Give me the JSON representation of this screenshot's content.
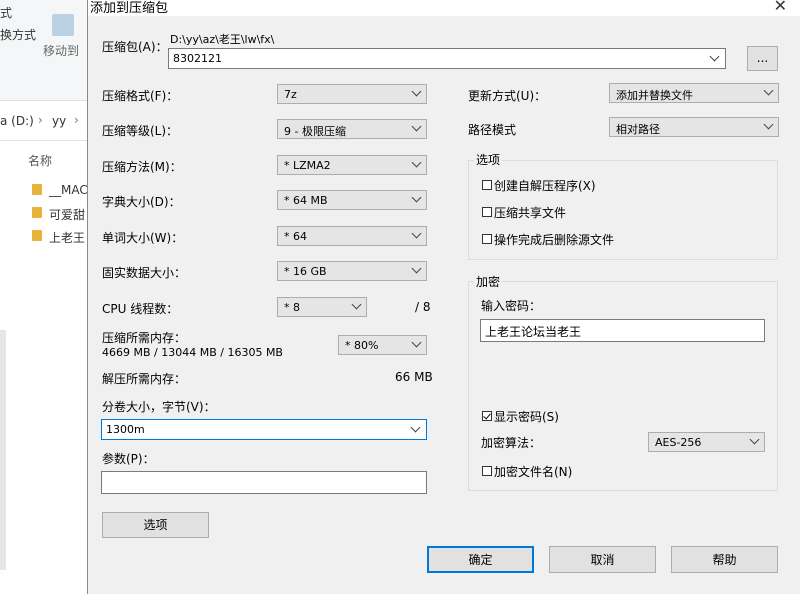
{
  "explorer": {
    "ribbon_label_1": "式",
    "ribbon_label_2": "换方式",
    "ribbon_move_label": "移动到",
    "path_segment_1": "a (D:)",
    "path_segment_2": "yy",
    "name_header": "名称",
    "files": [
      "__MAC",
      "可爱甜",
      "上老王"
    ]
  },
  "dialog": {
    "title": "添加到压缩包",
    "close_glyph": "✕",
    "archive_label": "压缩包(A)：",
    "archive_path": "D:\\yy\\az\\老王\\lw\\fx\\",
    "archive_name": "8302121",
    "browse_label": "...",
    "format_label": "压缩格式(F)：",
    "format_value": "7z",
    "level_label": "压缩等级(L)：",
    "level_value": "9 - 极限压缩",
    "method_label": "压缩方法(M)：",
    "method_value": "* LZMA2",
    "dict_label": "字典大小(D)：",
    "dict_value": "* 64 MB",
    "word_label": "单词大小(W)：",
    "word_value": "* 64",
    "solid_label": "固实数据大小：",
    "solid_value": "* 16 GB",
    "cpu_label": "CPU 线程数：",
    "cpu_value": "* 8",
    "cpu_total": "/ 8",
    "mem_label": "压缩所需内存：",
    "mem_detail": "4669 MB / 13044 MB / 16305 MB",
    "mem_percent": "* 80%",
    "decomp_label": "解压所需内存：",
    "decomp_value": "66 MB",
    "split_label": "分卷大小，字节(V)：",
    "split_value": "1300m",
    "params_label": "参数(P)：",
    "params_value": "",
    "options_button": "选项",
    "update_label": "更新方式(U)：",
    "update_value": "添加并替换文件",
    "path_mode_label": "路径模式",
    "path_mode_value": "相对路径",
    "options_group": "选项",
    "opt_sfx": "创建自解压程序(X)",
    "opt_shared": "压缩共享文件",
    "opt_delete": "操作完成后删除源文件",
    "encrypt_group": "加密",
    "password_label": "输入密码：",
    "password_value": "上老王论坛当老王",
    "show_password": "显示密码(S)",
    "enc_method_label": "加密算法：",
    "enc_method_value": "AES-256",
    "encrypt_names": "加密文件名(N)",
    "ok_button": "确定",
    "cancel_button": "取消",
    "help_button": "帮助"
  }
}
